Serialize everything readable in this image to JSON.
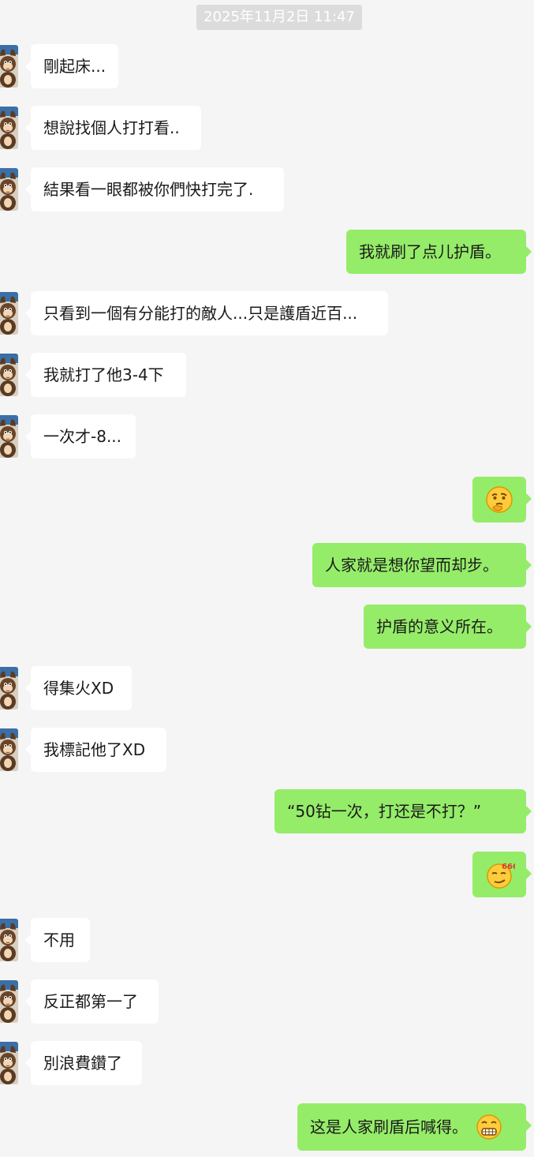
{
  "timestamp": "2025年11月2日 11:47",
  "messages": [
    {
      "side": "in",
      "text": "剛起床..."
    },
    {
      "side": "in",
      "text": "想說找個人打打看.."
    },
    {
      "side": "in",
      "text": "結果看一眼都被你們快打完了."
    },
    {
      "side": "out",
      "text": "我就刷了点儿护盾。"
    },
    {
      "side": "in",
      "text": "只看到一個有分能打的敵人...只是護盾近百..."
    },
    {
      "side": "in",
      "text": "我就打了他3-4下"
    },
    {
      "side": "in",
      "text": "一次才-8..."
    },
    {
      "side": "out",
      "emoji": "thinking-face-emoji"
    },
    {
      "side": "out",
      "text": "人家就是想你望而却步。"
    },
    {
      "side": "out",
      "text": "护盾的意义所在。"
    },
    {
      "side": "in",
      "text": "得集火XD"
    },
    {
      "side": "in",
      "text": "我標記他了XD"
    },
    {
      "side": "out",
      "text": "“50钻一次，打还是不打？”"
    },
    {
      "side": "out",
      "emoji": "smirk-666-emoji",
      "emoji_text": "666"
    },
    {
      "side": "in",
      "text": "不用"
    },
    {
      "side": "in",
      "text": "反正都第一了"
    },
    {
      "side": "in",
      "text": "別浪費鑽了"
    },
    {
      "side": "out",
      "text": "这是人家刷盾后喊得。",
      "emoji": "grimacing-face-emoji"
    }
  ],
  "colors": {
    "background": "#f5f5f5",
    "incoming_bubble": "#ffffff",
    "outgoing_bubble": "#95ec69",
    "timestamp_bg": "#dcdcdc"
  }
}
